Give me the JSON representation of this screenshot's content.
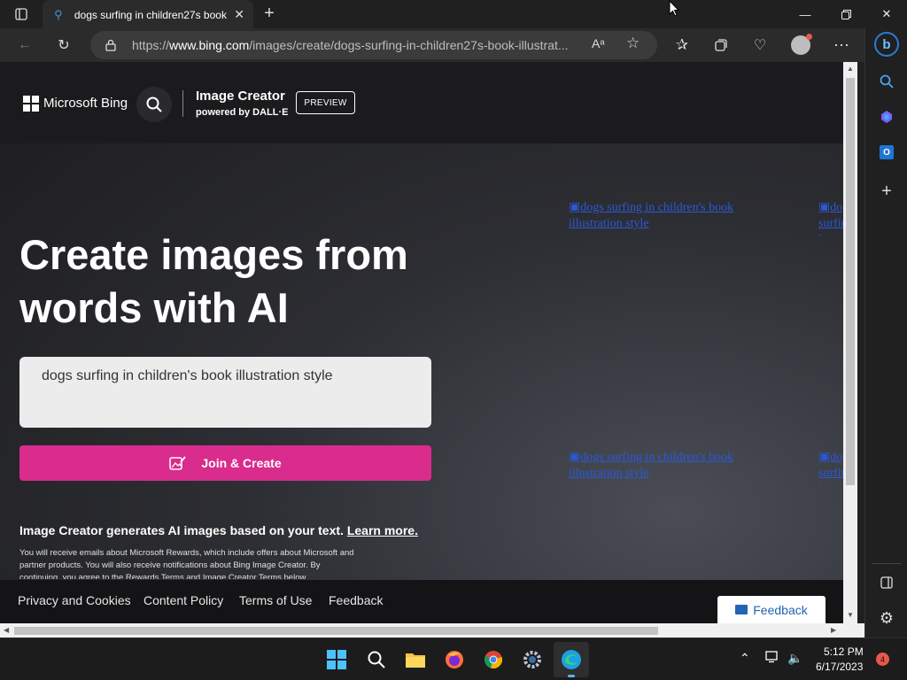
{
  "browser": {
    "tab_title": "dogs surfing in children27s book",
    "url_prefix": "https://",
    "url_domain": "www.bing.com",
    "url_path": "/images/create/dogs-surfing-in-children27s-book-illustrat...",
    "read_aloud_label": "Aᵃ"
  },
  "page": {
    "brand": "Microsoft Bing",
    "product_title": "Image Creator",
    "product_sub": "powered by DALL·E",
    "badge": "PREVIEW",
    "hero": "Create images from words with AI",
    "prompt": "dogs surfing in children's book illustration style",
    "join_label": "Join & Create",
    "info_text": "Image Creator generates AI images based on your text. ",
    "info_link": "Learn more.",
    "legal": "You will receive emails about Microsoft Rewards, which include offers about Microsoft and partner products. You will also receive notifications about Bing Image Creator. By continuing, you agree to the Rewards Terms and Image Creator Terms below.",
    "alt_images": [
      "dogs surfing in children's book illustration style",
      "dogs surfing in children's book illustration style",
      "dogs surfing in children's book illustration style",
      "dogs surfing in children's book illustration style"
    ]
  },
  "footer": {
    "links": [
      "Privacy and Cookies",
      "Content Policy",
      "Terms of Use",
      "Feedback"
    ],
    "feedback_button": "Feedback"
  },
  "taskbar": {
    "time": "5:12 PM",
    "date": "6/17/2023",
    "notifications": "4"
  },
  "colors": {
    "accent_pink": "#d92c8d",
    "link_blue": "#2b58d6"
  }
}
